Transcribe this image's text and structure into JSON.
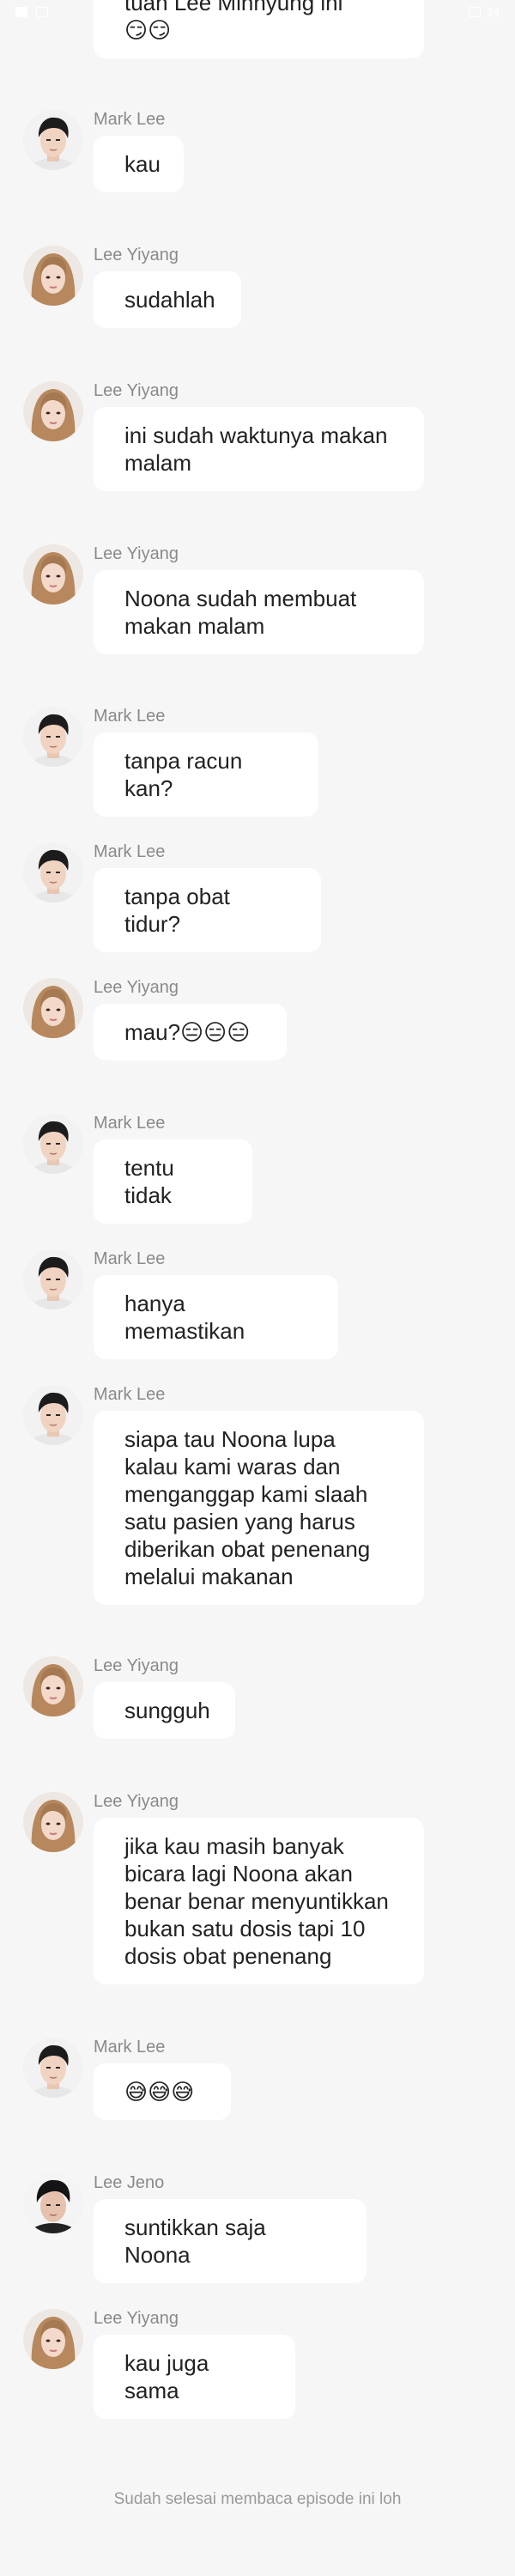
{
  "status_bar": {
    "right_text": "24"
  },
  "messages": [
    {
      "name": "",
      "text": "tuan Lee Minhyung ini\n😏😏",
      "avatar": ""
    },
    {
      "name": "Mark Lee",
      "text": "kau",
      "avatar": "mark-lee-avatar"
    },
    {
      "name": "Lee Yiyang",
      "text": "sudahlah",
      "avatar": "lee-yiyang-avatar"
    },
    {
      "name": "Lee Yiyang",
      "text": "ini sudah waktunya makan\nmalam",
      "avatar": "lee-yiyang-avatar"
    },
    {
      "name": "Lee Yiyang",
      "text": "Noona sudah membuat\nmakan malam",
      "avatar": "lee-yiyang-avatar"
    },
    {
      "name": "Mark Lee",
      "text": "tanpa racun kan?",
      "avatar": "mark-lee-avatar"
    },
    {
      "name": "Mark Lee",
      "text": "tanpa obat tidur?",
      "avatar": "mark-lee-avatar"
    },
    {
      "name": "Lee Yiyang",
      "text": "mau?😑😑😑",
      "avatar": "lee-yiyang-avatar"
    },
    {
      "name": "Mark Lee",
      "text": "tentu tidak",
      "avatar": "mark-lee-avatar"
    },
    {
      "name": "Mark Lee",
      "text": "hanya memastikan",
      "avatar": "mark-lee-avatar"
    },
    {
      "name": "Mark Lee",
      "text": "siapa tau Noona lupa\nkalau kami waras dan\nmenganggap kami slaah\nsatu pasien yang harus\ndiberikan obat penenang\nmelalui makanan",
      "avatar": "mark-lee-avatar"
    },
    {
      "name": "Lee Yiyang",
      "text": "sungguh",
      "avatar": "lee-yiyang-avatar"
    },
    {
      "name": "Lee Yiyang",
      "text": "jika kau masih banyak\nbicara lagi Noona akan\nbenar benar menyuntikkan\nbukan satu dosis tapi 10\ndosis obat penenang",
      "avatar": "lee-yiyang-avatar"
    },
    {
      "name": "Mark Lee",
      "text": "😅😅😅",
      "avatar": "mark-lee-avatar"
    },
    {
      "name": "Lee Jeno",
      "text": "suntikkan saja Noona",
      "avatar": "lee-jeno-avatar"
    },
    {
      "name": "Lee Yiyang",
      "text": "kau juga sama",
      "avatar": "lee-yiyang-avatar"
    }
  ],
  "footer": {
    "note": "Sudah selesai membaca episode ini loh"
  }
}
